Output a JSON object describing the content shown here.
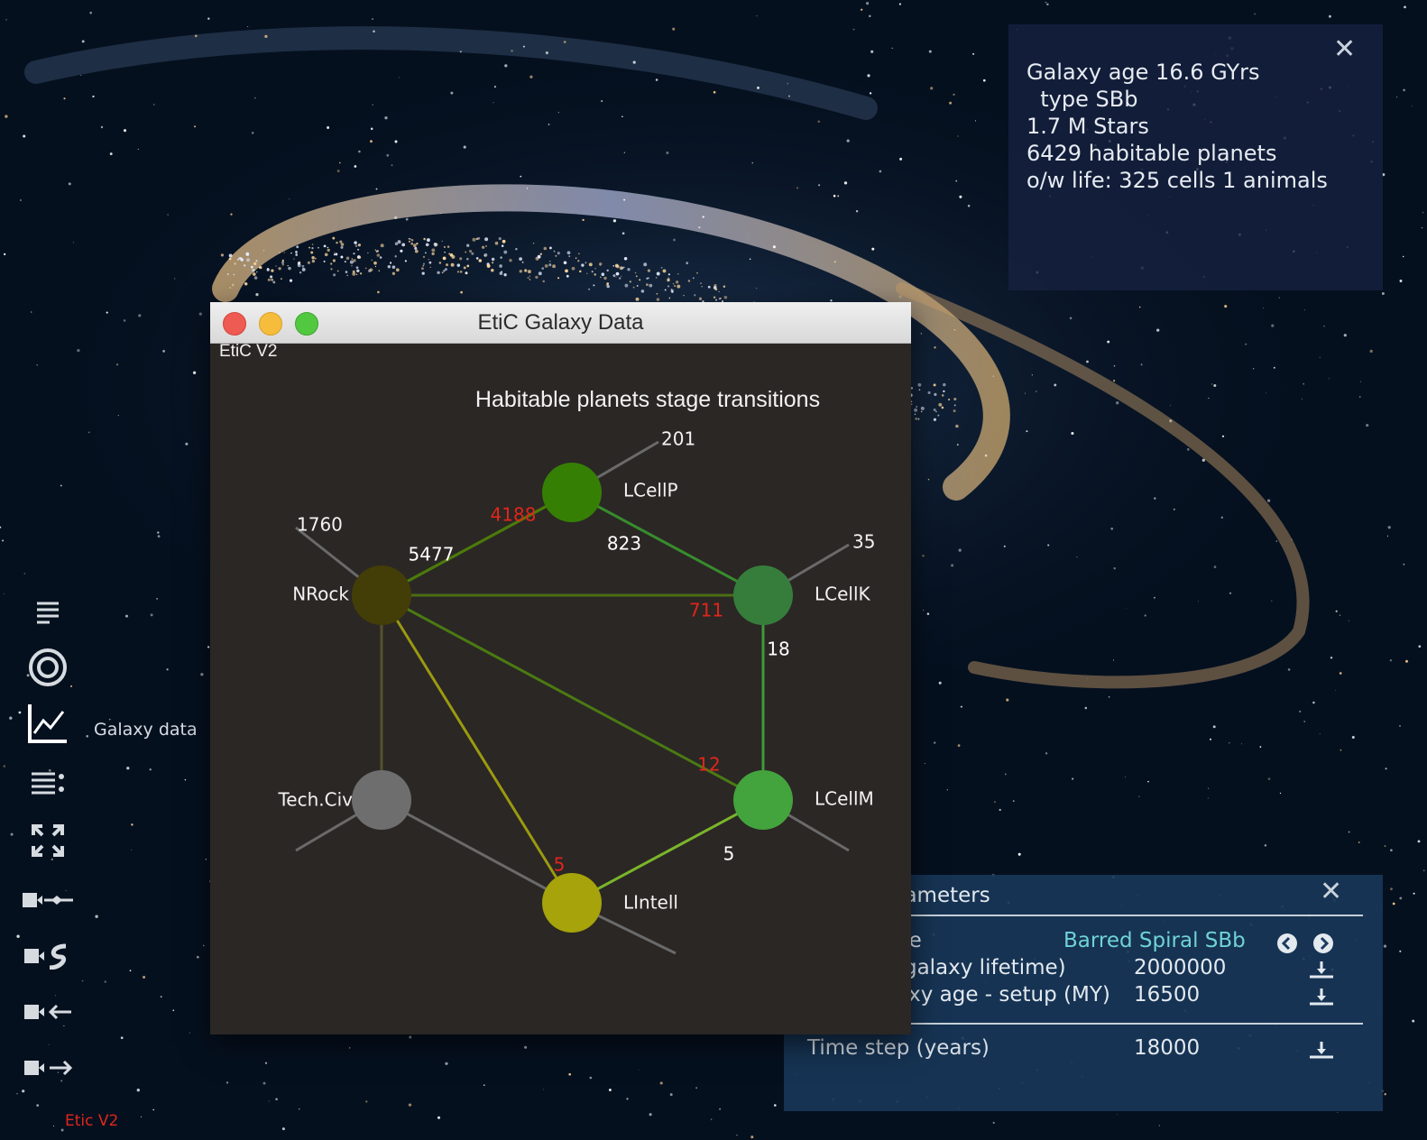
{
  "colors": {
    "background": "#05101f",
    "window_bg": "#2b2725",
    "accent_red": "#e0261b",
    "accent_cyan": "#6fd3d6"
  },
  "toolbar": {
    "items": [
      {
        "icon": "lines-icon"
      },
      {
        "icon": "target-icon"
      },
      {
        "icon": "chart-icon",
        "label": "Galaxy data"
      },
      {
        "icon": "list-settings-icon"
      },
      {
        "icon": "expand-arrows-icon"
      },
      {
        "icon": "camera-slider-icon"
      },
      {
        "icon": "camera-spiral-icon"
      },
      {
        "icon": "camera-left-icon"
      },
      {
        "icon": "camera-right-icon"
      }
    ],
    "footer": "Etic V2"
  },
  "info": {
    "lines": [
      "Galaxy age 16.6 GYrs",
      "  type SBb",
      "1.7 M Stars",
      "6429 habitable planets",
      "o/w life: 325 cells 1 animals"
    ]
  },
  "parameters": {
    "title": "rameters",
    "rows": [
      {
        "label": "pe",
        "value": "Barred Spiral SBb"
      },
      {
        "label": "(galaxy lifetime)",
        "value": "2000000"
      },
      {
        "label": "axy age - setup (MY)",
        "value": "16500"
      },
      {
        "label": "Time step (years)",
        "value": "18000"
      }
    ]
  },
  "window": {
    "title": "EtiC Galaxy Data",
    "menu": "EtiC V2"
  },
  "chart_data": {
    "type": "network",
    "title": "Habitable planets stage transitions",
    "nodes": [
      {
        "id": "NRock",
        "color": "#433e08"
      },
      {
        "id": "LCellP",
        "color": "#367f05"
      },
      {
        "id": "LCellK",
        "color": "#367d3c"
      },
      {
        "id": "LCellM",
        "color": "#43a33c"
      },
      {
        "id": "LIntell",
        "color": "#a6a30b"
      },
      {
        "id": "Tech.Civ",
        "color": "#6e6e6e"
      }
    ],
    "edges": [
      {
        "from": "NRock",
        "to": "LCellP",
        "value": "5477",
        "label_color": "#ffffff",
        "color": "#4b7a0a"
      },
      {
        "from": "NRock",
        "to": "LCellP",
        "value": "4188",
        "label_color": "#e0261b",
        "color": "#4b7a0a"
      },
      {
        "from": "LCellP",
        "to": "LCellK",
        "value": "823",
        "label_color": "#ffffff",
        "color": "#378c2d"
      },
      {
        "from": "NRock",
        "to": "LCellK",
        "value": "711",
        "label_color": "#e0261b",
        "color": "#4a6e12"
      },
      {
        "from": "LCellK",
        "to": "LCellM",
        "value": "18",
        "label_color": "#ffffff",
        "color": "#3f9a3a"
      },
      {
        "from": "NRock",
        "to": "LCellM",
        "value": "12",
        "label_color": "#e0261b",
        "color": "#4a7a12"
      },
      {
        "from": "LCellM",
        "to": "LIntell",
        "value": "5",
        "label_color": "#ffffff",
        "color": "#7ab52a"
      },
      {
        "from": "NRock",
        "to": "LIntell",
        "value": "5",
        "label_color": "#e0261b",
        "color": "#9a9a10"
      },
      {
        "from": "NRock",
        "to": "Tech.Civ",
        "value": "",
        "label_color": "#ffffff",
        "color": "#55522a"
      }
    ],
    "outflows": [
      {
        "node": "NRock",
        "value": "1760"
      },
      {
        "node": "LCellP",
        "value": "201"
      },
      {
        "node": "LCellK",
        "value": "35"
      },
      {
        "node": "LCellM",
        "value": ""
      },
      {
        "node": "LIntell",
        "value": ""
      },
      {
        "node": "Tech.Civ",
        "value": ""
      }
    ]
  }
}
